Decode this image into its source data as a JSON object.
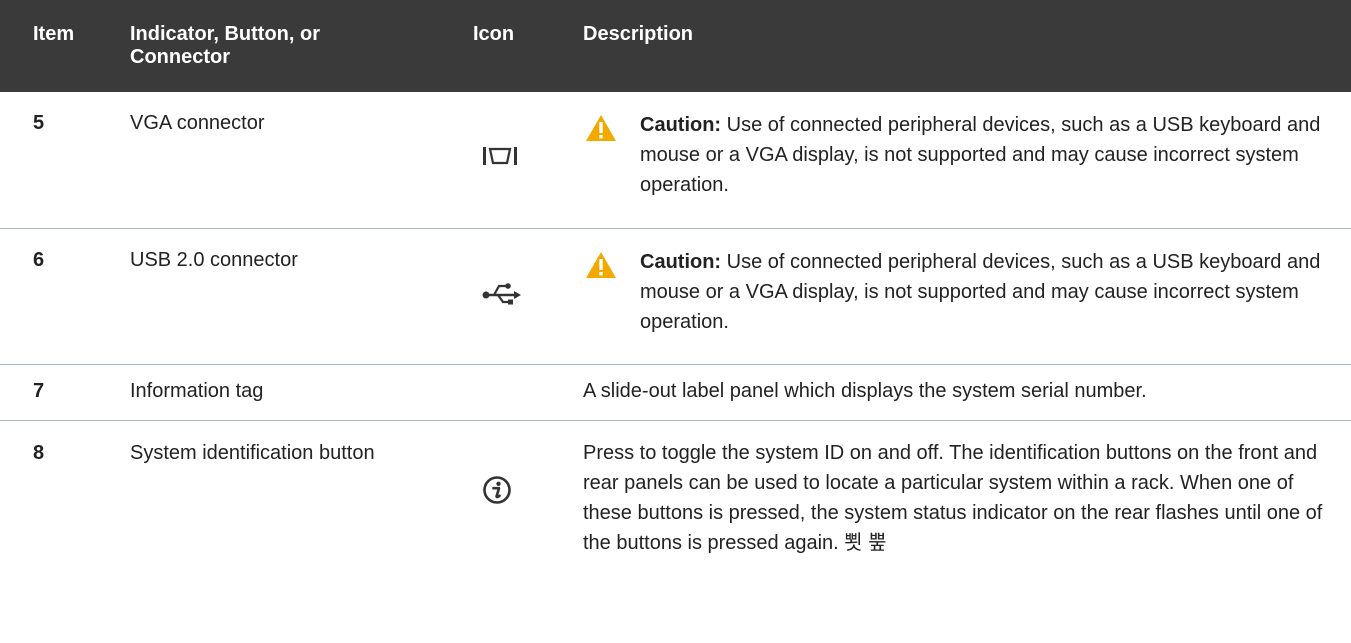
{
  "header": {
    "item": "Item",
    "indicator": "Indicator, Button, or Connector",
    "icon": "Icon",
    "description": "Description"
  },
  "rows": [
    {
      "item": "5",
      "name": "VGA connector",
      "icon": "vga-connector-icon",
      "caution_label": "Caution:",
      "description": " Use of connected peripheral devices, such as a USB keyboard and mouse or a VGA display, is not supported and may cause incorrect system operation."
    },
    {
      "item": "6",
      "name": "USB 2.0 connector",
      "icon": "usb-icon",
      "caution_label": "Caution:",
      "description": " Use of connected peripheral devices, such as a USB keyboard and mouse or a VGA display, is not supported and may cause incorrect system operation."
    },
    {
      "item": "7",
      "name": "Information tag",
      "description": "A slide-out label panel which displays the system serial number."
    },
    {
      "item": "8",
      "name": "System identification button",
      "icon": "info-icon",
      "description": "Press to toggle the system ID on and off. The identification buttons on the front and rear panels can be used to locate a particular system within a rack. When one of these buttons is pressed, the system status indicator on the rear flashes until one of the buttons is pressed again. 뾧 뿦"
    }
  ],
  "colors": {
    "header_bg": "#3a3a3a",
    "warning": "#f2a900",
    "divider": "#aeb9c0"
  }
}
